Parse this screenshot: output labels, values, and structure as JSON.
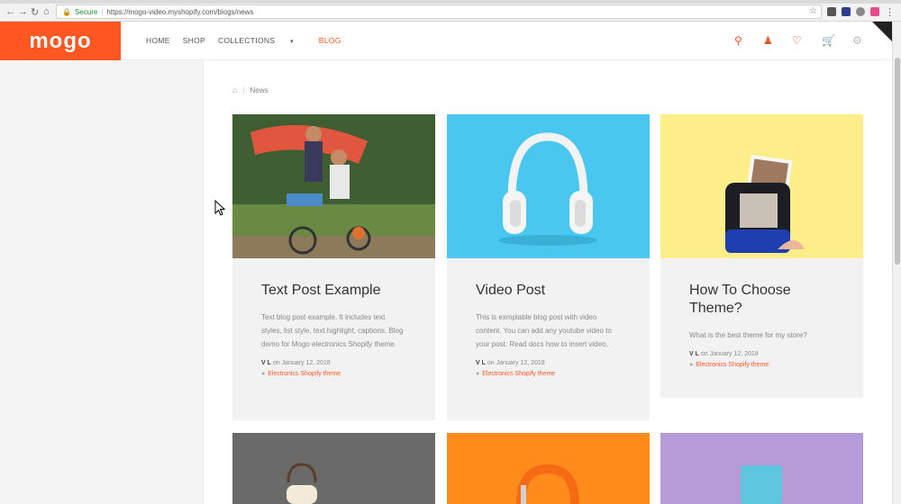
{
  "browser": {
    "secure_label": "Secure",
    "url": "https://mogo-video.myshopify.com/blogs/news"
  },
  "store": {
    "logo": "mogo",
    "menu": [
      {
        "label": "HOME",
        "active": false
      },
      {
        "label": "SHOP",
        "active": false
      },
      {
        "label": "COLLECTIONS",
        "active": false
      },
      {
        "label": "BLOG",
        "active": true
      }
    ],
    "icons": [
      "search-icon",
      "user-icon",
      "heart-icon",
      "cart-icon",
      "gear-icon"
    ]
  },
  "breadcrumb": {
    "current": "News"
  },
  "posts": [
    {
      "title": "Text Post Example",
      "excerpt": "Text blog post example. It includes text styles, list style, text highlight, captions. Blog demo for Mogo electronics Shopify theme.",
      "author": "V L",
      "date_prefix": "on",
      "date": "January 12, 2018",
      "tag": "Electronics Shopify theme"
    },
    {
      "title": "Video Post",
      "excerpt": "This is exmplable blog post with video content. You can add any youtube video to your post. Read docs how to insert video.",
      "author": "V L",
      "date_prefix": "on",
      "date": "January 12, 2018",
      "tag": "Electronics Shopify theme"
    },
    {
      "title": "How To Choose Theme?",
      "excerpt": "What is the best theme for my store?",
      "author": "V L",
      "date_prefix": "on",
      "date": "January 12, 2018",
      "tag": "Electronics Shopify theme"
    }
  ],
  "colors": {
    "brand": "#ff5722",
    "card_bg": "#f2f2f2",
    "headphones_bg": "#49c7ef",
    "camera_bg": "#fdee8a",
    "band_bg": "#ff8c1a",
    "phone_bg": "#b79bd6"
  }
}
